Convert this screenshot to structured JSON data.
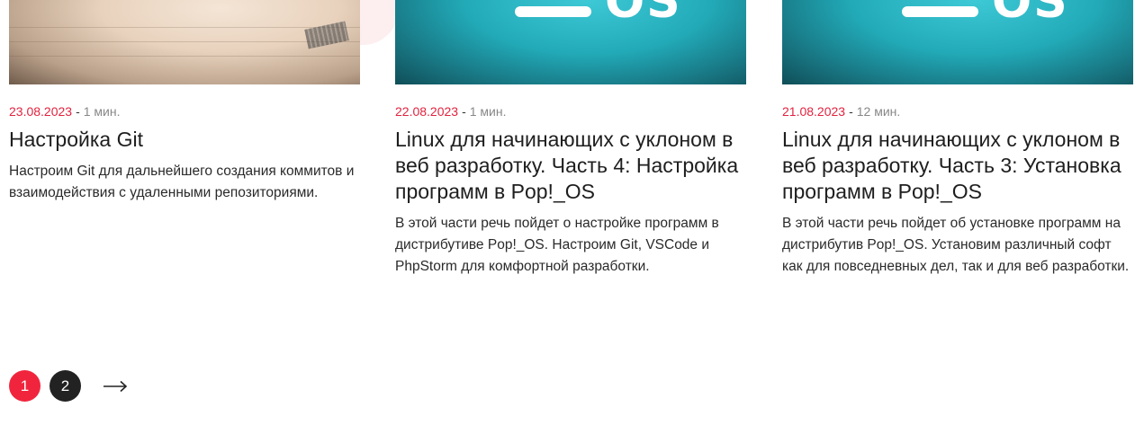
{
  "cards": [
    {
      "date": "23.08.2023",
      "separator": "-",
      "read_time": "1 мин.",
      "title": "Настройка Git",
      "description": "Настроим Git для дальнейшего создания коммитов и взаимодействия с удаленными репозиториями."
    },
    {
      "date": "22.08.2023",
      "separator": "-",
      "read_time": "1 мин.",
      "title": "Linux для начинающих с уклоном в веб разработку. Часть 4: Настройка программ в Pop!_OS",
      "description": "В этой части речь пойдет о настройке программ в дистрибутиве Pop!_OS. Настроим Git, VSCode и PhpStorm для комфортной разработки."
    },
    {
      "date": "21.08.2023",
      "separator": "-",
      "read_time": "12 мин.",
      "title": "Linux для начинающих с уклоном в веб разработку. Часть 3: Установка программ в Pop!_OS",
      "description": "В этой части речь пойдет об установке программ на дистрибутив Pop!_OS. Установим различный софт как для повседневных дел, так и для веб разработки."
    }
  ],
  "pagination": {
    "pages": [
      "1",
      "2"
    ],
    "current": "1",
    "next_icon": "arrow-right-icon"
  },
  "colors": {
    "accent": "#f0253d",
    "date": "#e2233f",
    "dark": "#222222",
    "muted": "#888888"
  }
}
